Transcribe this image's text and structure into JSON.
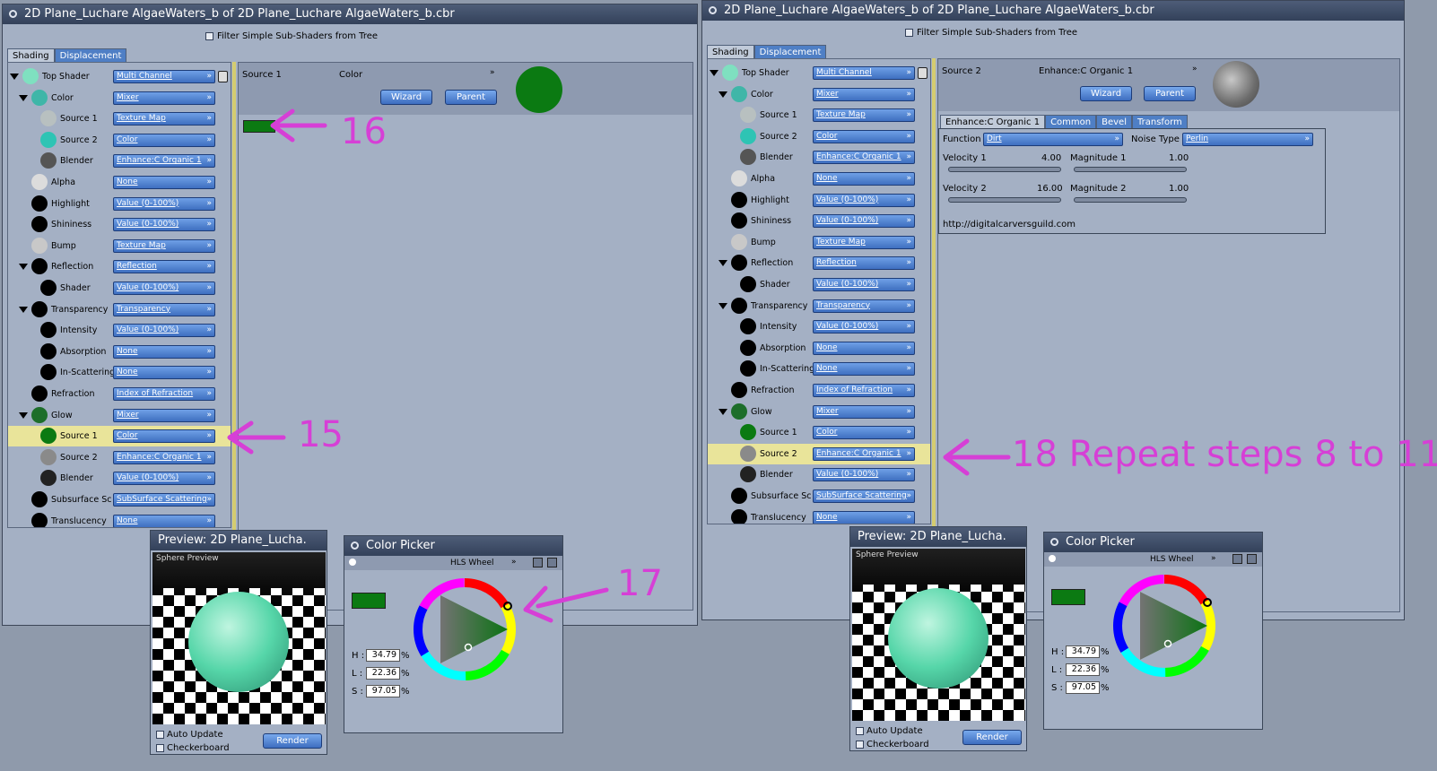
{
  "left": {
    "title": "2D Plane_Luchare AlgaeWaters_b of 2D Plane_Luchare AlgaeWaters_b.cbr",
    "filter": "Filter Simple Sub-Shaders from Tree",
    "tabs": [
      "Shading",
      "Displacement"
    ],
    "tree": [
      {
        "label": "Top Shader",
        "value": "Multi Channel",
        "indent": 0,
        "ball": "#7fe0c0",
        "tri": true
      },
      {
        "label": "Color",
        "value": "Mixer",
        "indent": 1,
        "ball": "#3fb6a8",
        "tri": true
      },
      {
        "label": "Source 1",
        "value": "Texture Map",
        "indent": 2,
        "ball": "#b8c0c0"
      },
      {
        "label": "Source 2",
        "value": "Color",
        "indent": 2,
        "ball": "#2ec4b4"
      },
      {
        "label": "Blender",
        "value": "Enhance:C Organic 1",
        "indent": 2,
        "ball": "#555"
      },
      {
        "label": "Alpha",
        "value": "None",
        "indent": 1,
        "ball": "#dcdcdc"
      },
      {
        "label": "Highlight",
        "value": "Value (0-100%)",
        "indent": 1,
        "ball": "#000"
      },
      {
        "label": "Shininess",
        "value": "Value (0-100%)",
        "indent": 1,
        "ball": "#000"
      },
      {
        "label": "Bump",
        "value": "Texture Map",
        "indent": 1,
        "ball": "#c8c8c8"
      },
      {
        "label": "Reflection",
        "value": "Reflection",
        "indent": 1,
        "ball": "#000",
        "tri": true
      },
      {
        "label": "Shader",
        "value": "Value (0-100%)",
        "indent": 2,
        "ball": "#000"
      },
      {
        "label": "Transparency",
        "value": "Transparency",
        "indent": 1,
        "ball": "#000",
        "tri": true
      },
      {
        "label": "Intensity",
        "value": "Value (0-100%)",
        "indent": 2,
        "ball": "#000"
      },
      {
        "label": "Absorption",
        "value": "None",
        "indent": 2,
        "ball": "#000"
      },
      {
        "label": "In-Scattering",
        "value": "None",
        "indent": 2,
        "ball": "#000"
      },
      {
        "label": "Refraction",
        "value": "Index of Refraction",
        "indent": 1,
        "ball": "#000"
      },
      {
        "label": "Glow",
        "value": "Mixer",
        "indent": 1,
        "ball": "#1d6e2a",
        "tri": true
      },
      {
        "label": "Source 1",
        "value": "Color",
        "indent": 2,
        "ball": "#0b7a12",
        "sel": true
      },
      {
        "label": "Source 2",
        "value": "Enhance:C Organic 1",
        "indent": 2,
        "ball": "#8a8a8a"
      },
      {
        "label": "Blender",
        "value": "Value (0-100%)",
        "indent": 2,
        "ball": "#222"
      },
      {
        "label": "Subsurface Sc",
        "value": "SubSurface Scattering",
        "indent": 1,
        "ball": "#000"
      },
      {
        "label": "Translucency",
        "value": "None",
        "indent": 1,
        "ball": "#000"
      }
    ],
    "source_label": "Source 1",
    "type_label": "Color",
    "wizard": "Wizard",
    "parent": "Parent"
  },
  "right": {
    "title": "2D Plane_Luchare AlgaeWaters_b of 2D Plane_Luchare AlgaeWaters_b.cbr",
    "filter": "Filter Simple Sub-Shaders from Tree",
    "tabs": [
      "Shading",
      "Displacement"
    ],
    "tree": [
      {
        "label": "Top Shader",
        "value": "Multi Channel",
        "indent": 0,
        "ball": "#7fe0c0",
        "tri": true
      },
      {
        "label": "Color",
        "value": "Mixer",
        "indent": 1,
        "ball": "#3fb6a8",
        "tri": true
      },
      {
        "label": "Source 1",
        "value": "Texture Map",
        "indent": 2,
        "ball": "#b8c0c0"
      },
      {
        "label": "Source 2",
        "value": "Color",
        "indent": 2,
        "ball": "#2ec4b4"
      },
      {
        "label": "Blender",
        "value": "Enhance:C Organic 1",
        "indent": 2,
        "ball": "#555"
      },
      {
        "label": "Alpha",
        "value": "None",
        "indent": 1,
        "ball": "#dcdcdc"
      },
      {
        "label": "Highlight",
        "value": "Value (0-100%)",
        "indent": 1,
        "ball": "#000"
      },
      {
        "label": "Shininess",
        "value": "Value (0-100%)",
        "indent": 1,
        "ball": "#000"
      },
      {
        "label": "Bump",
        "value": "Texture Map",
        "indent": 1,
        "ball": "#c8c8c8"
      },
      {
        "label": "Reflection",
        "value": "Reflection",
        "indent": 1,
        "ball": "#000",
        "tri": true
      },
      {
        "label": "Shader",
        "value": "Value (0-100%)",
        "indent": 2,
        "ball": "#000"
      },
      {
        "label": "Transparency",
        "value": "Transparency",
        "indent": 1,
        "ball": "#000",
        "tri": true
      },
      {
        "label": "Intensity",
        "value": "Value (0-100%)",
        "indent": 2,
        "ball": "#000"
      },
      {
        "label": "Absorption",
        "value": "None",
        "indent": 2,
        "ball": "#000"
      },
      {
        "label": "In-Scattering",
        "value": "None",
        "indent": 2,
        "ball": "#000"
      },
      {
        "label": "Refraction",
        "value": "Index of Refraction",
        "indent": 1,
        "ball": "#000"
      },
      {
        "label": "Glow",
        "value": "Mixer",
        "indent": 1,
        "ball": "#1d6e2a",
        "tri": true
      },
      {
        "label": "Source 1",
        "value": "Color",
        "indent": 2,
        "ball": "#0b7a12"
      },
      {
        "label": "Source 2",
        "value": "Enhance:C Organic 1",
        "indent": 2,
        "ball": "#8a8a8a",
        "sel": true
      },
      {
        "label": "Blender",
        "value": "Value (0-100%)",
        "indent": 2,
        "ball": "#222"
      },
      {
        "label": "Subsurface Sc",
        "value": "SubSurface Scattering",
        "indent": 1,
        "ball": "#000"
      },
      {
        "label": "Translucency",
        "value": "None",
        "indent": 1,
        "ball": "#000"
      }
    ],
    "source_label": "Source 2",
    "type_label": "Enhance:C Organic 1",
    "wizard": "Wizard",
    "parent": "Parent",
    "subtabs": [
      "Enhance:C Organic 1",
      "Common",
      "Bevel",
      "Transform"
    ],
    "function_label": "Function",
    "function_value": "Dirt",
    "noise_label": "Noise Type",
    "noise_value": "Perlin",
    "velocity1_label": "Velocity 1",
    "velocity1_value": "4.00",
    "magnitude1_label": "Magnitude 1",
    "magnitude1_value": "1.00",
    "velocity2_label": "Velocity 2",
    "velocity2_value": "16.00",
    "magnitude2_label": "Magnitude 2",
    "magnitude2_value": "1.00",
    "url": "http://digitalcarversguild.com"
  },
  "preview": {
    "title": "Preview: 2D Plane_Lucha.",
    "overlay": "Sphere Preview",
    "auto_update": "Auto Update",
    "checkerboard": "Checkerboard",
    "render": "Render"
  },
  "picker": {
    "title": "Color Picker",
    "mode": "HLS Wheel",
    "h_label": "H :",
    "l_label": "L :",
    "s_label": "S :",
    "h": "34.79",
    "l": "22.36",
    "s": "97.05",
    "pct": "%",
    "color": "#0b7a12"
  },
  "annotations": {
    "a15": "15",
    "a16": "16",
    "a17": "17",
    "a18": "18 Repeat steps 8 to 11"
  },
  "colors": {
    "accent": "#d63fd6",
    "selected_row": "#e9e49a",
    "green": "#0b7a12"
  }
}
